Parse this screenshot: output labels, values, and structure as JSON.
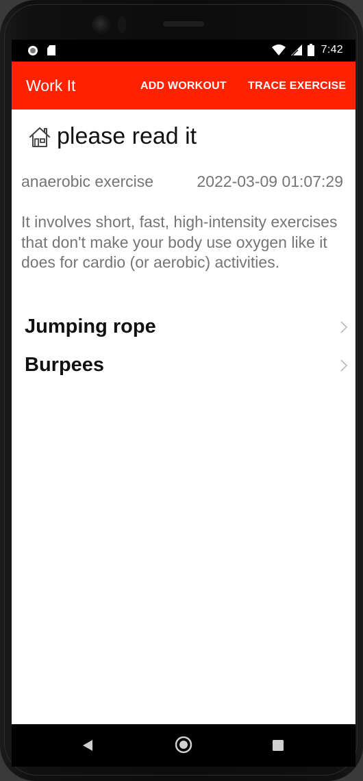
{
  "status_bar": {
    "time": "7:42"
  },
  "app_bar": {
    "title": "Work It",
    "actions": [
      "ADD WORKOUT",
      "TRACE EXERCISE"
    ]
  },
  "workout": {
    "title": "please read it",
    "type": "anaerobic exercise",
    "datetime": "2022-03-09 01:07:29",
    "description": "It involves short, fast, high-intensity exercises that don't make your body use oxygen like it does for cardio (or aerobic) activities.",
    "exercises": [
      "Jumping rope",
      "Burpees"
    ]
  },
  "colors": {
    "accent": "#ff2200",
    "secondary_text": "#757575"
  },
  "icons": [
    "home-icon",
    "chevron-right-icon",
    "wifi-icon",
    "signal-icon",
    "battery-icon",
    "back-icon",
    "home-nav-icon",
    "recents-icon"
  ]
}
